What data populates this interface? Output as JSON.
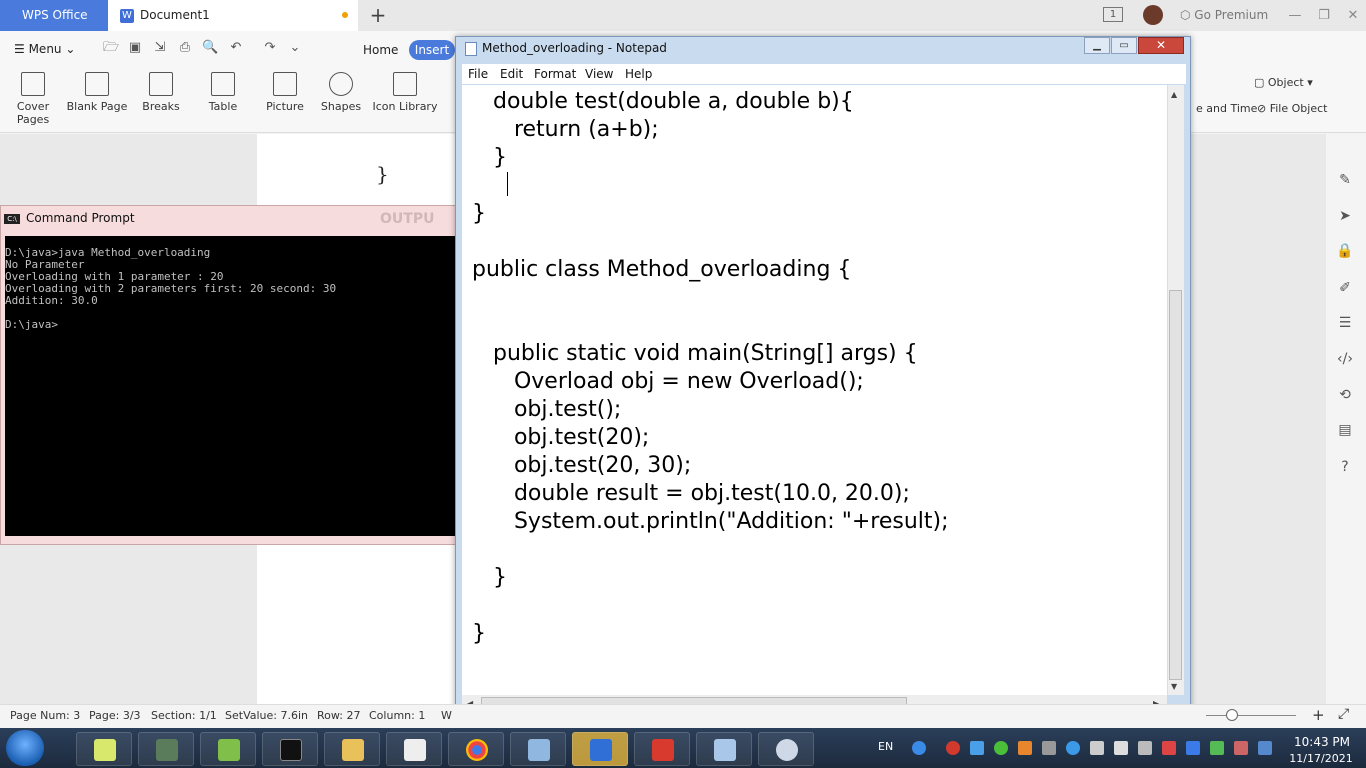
{
  "wps": {
    "app_tab": "WPS Office",
    "doc_tab": "Document1",
    "new_tab": "+",
    "go_premium": "Go Premium",
    "page_indicator": "1",
    "menu_label": "Menu",
    "home_tab": "Home",
    "insert_tab": "Insert",
    "ribbon": [
      {
        "label": "Cover Pages",
        "icon": "cover-pages-icon"
      },
      {
        "label": "Blank Page",
        "icon": "blank-page-icon"
      },
      {
        "label": "Breaks",
        "icon": "breaks-icon"
      },
      {
        "label": "Table",
        "icon": "table-icon"
      },
      {
        "label": "Picture",
        "icon": "picture-icon"
      },
      {
        "label": "Shapes",
        "icon": "shapes-icon"
      },
      {
        "label": "Icon Library",
        "icon": "icon-library-icon"
      }
    ],
    "ribbon_right": {
      "object": "Object",
      "date_time": "e and Time",
      "file_object": "File Object"
    },
    "doc_fragment": "}",
    "status": {
      "page_num": "Page Num: 3",
      "page": "Page: 3/3",
      "section": "Section: 1/1",
      "set_value": "SetValue: 7.6in",
      "row": "Row: 27",
      "column": "Column: 1",
      "cut": "W"
    },
    "accent": "#4a7bdc"
  },
  "cmd": {
    "title": "Command Prompt",
    "ghost": "OUTPU",
    "lines": [
      "D:\\java>java Method_overloading",
      "No Parameter",
      "Overloading with 1 parameter : 20",
      "Overloading with 2 parameters first: 20 second: 30",
      "Addition: 30.0",
      "",
      "D:\\java>"
    ]
  },
  "notepad": {
    "title": "Method_overloading - Notepad",
    "menu": [
      "File",
      "Edit",
      "Format",
      "View",
      "Help"
    ],
    "code": [
      "   double test(double a, double b){",
      "      return (a+b);",
      "   }",
      "",
      "}",
      "",
      "public class Method_overloading {",
      "",
      "",
      "   public static void main(String[] args) {",
      "      Overload obj = new Overload();",
      "      obj.test();",
      "      obj.test(20);",
      "      obj.test(20, 30);",
      "      double result = obj.test(10.0, 20.0);",
      "      System.out.println(\"Addition: \"+result);",
      "",
      "   }",
      "",
      "}"
    ]
  },
  "taskbar": {
    "lang": "EN",
    "time": "10:43 PM",
    "date": "11/17/2021"
  }
}
